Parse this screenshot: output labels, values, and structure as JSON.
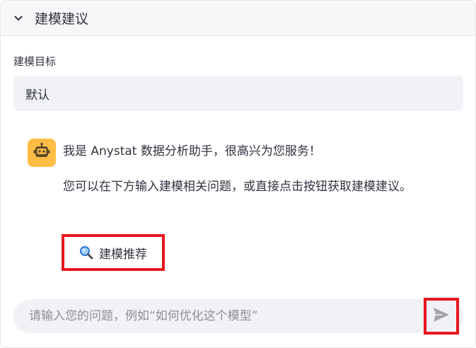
{
  "expander": {
    "title": "建模建议",
    "expanded": true
  },
  "field": {
    "label": "建模目标",
    "value": "默认"
  },
  "assistant": {
    "avatar_icon": "robot-icon",
    "avatar_color": "#ffbd45",
    "greeting": "我是 Anystat 数据分析助手，很高兴为您服务！",
    "instruction": "您可以在下方输入建模相关问题，或直接点击按钮获取建模建议。"
  },
  "recommend_button": {
    "icon": "magnifier-icon",
    "label": "建模推荐"
  },
  "chat": {
    "placeholder": "请输入您的问题，例如“如何优化这个模型”",
    "send_icon": "send-icon"
  },
  "colors": {
    "highlight": "#e8161e",
    "input_bg": "#f0f2f6",
    "text": "#31333f"
  }
}
